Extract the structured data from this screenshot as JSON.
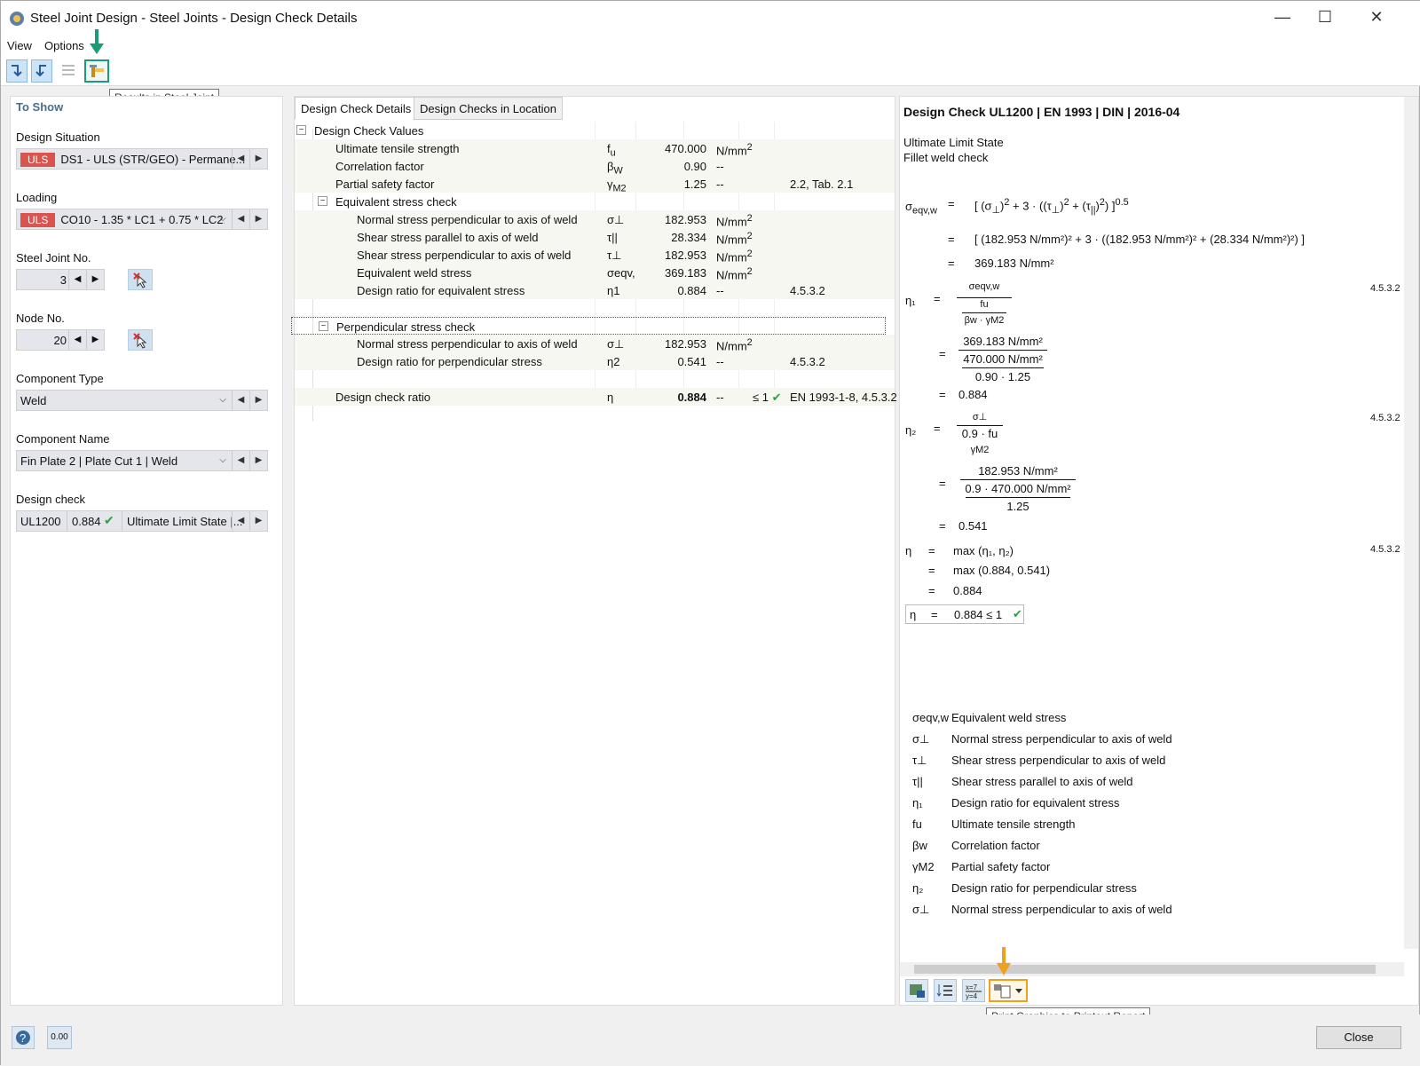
{
  "window": {
    "title": "Steel Joint Design - Steel Joints - Design Check Details",
    "minimize": "—",
    "maximize": "☐",
    "close": "✕"
  },
  "menu": {
    "view": "View",
    "options": "Options"
  },
  "tooltips": {
    "results_in_joint": "Results in Steel Joint",
    "print_graphics": "Print Graphics to Printout Report"
  },
  "left": {
    "header": "To Show",
    "design_situation_label": "Design Situation",
    "design_situation_badge": "ULS",
    "design_situation_value": "DS1 - ULS (STR/GEO) - Permane...",
    "loading_label": "Loading",
    "loading_badge": "ULS",
    "loading_value": "CO10 - 1.35 * LC1 + 0.75 * LC2...",
    "joint_label": "Steel Joint No.",
    "joint_value": "3",
    "node_label": "Node No.",
    "node_value": "20",
    "component_type_label": "Component Type",
    "component_type_value": "Weld",
    "component_name_label": "Component Name",
    "component_name_value": "Fin Plate 2 | Plate Cut 1 | Weld",
    "design_check_label": "Design check",
    "design_check_id": "UL1200",
    "design_check_ratio": "0.884",
    "design_check_desc": "Ultimate Limit State |..."
  },
  "tabs": [
    "Design Check Details",
    "Design Checks in Location"
  ],
  "grid": {
    "group_main": "Design Check Values",
    "rows": [
      {
        "name": "Ultimate tensile strength",
        "sym": "fu",
        "val": "470.000",
        "unit": "N/mm²",
        "cmp": "",
        "ref": ""
      },
      {
        "name": "Correlation factor",
        "sym": "βw",
        "val": "0.90",
        "unit": "--",
        "cmp": "",
        "ref": ""
      },
      {
        "name": "Partial safety factor",
        "sym": "γM2",
        "val": "1.25",
        "unit": "--",
        "cmp": "",
        "ref": "2.2, Tab. 2.1"
      }
    ],
    "group_equiv": "Equivalent stress check",
    "equiv_rows": [
      {
        "name": "Normal stress perpendicular to axis of weld",
        "sym": "σ⊥",
        "val": "182.953",
        "unit": "N/mm²",
        "ref": ""
      },
      {
        "name": "Shear stress parallel to axis of weld",
        "sym": "τ||",
        "val": "28.334",
        "unit": "N/mm²",
        "ref": ""
      },
      {
        "name": "Shear stress perpendicular to axis of weld",
        "sym": "τ⊥",
        "val": "182.953",
        "unit": "N/mm²",
        "ref": ""
      },
      {
        "name": "Equivalent weld stress",
        "sym": "σeqv,",
        "val": "369.183",
        "unit": "N/mm²",
        "ref": ""
      },
      {
        "name": "Design ratio for equivalent stress",
        "sym": "η1",
        "val": "0.884",
        "unit": "--",
        "ref": "4.5.3.2"
      }
    ],
    "group_perp": "Perpendicular stress check",
    "perp_rows": [
      {
        "name": "Normal stress perpendicular to axis of weld",
        "sym": "σ⊥",
        "val": "182.953",
        "unit": "N/mm²",
        "ref": ""
      },
      {
        "name": "Design ratio for perpendicular stress",
        "sym": "η2",
        "val": "0.541",
        "unit": "--",
        "ref": "4.5.3.2"
      }
    ],
    "final": {
      "name": "Design check ratio",
      "sym": "η",
      "val": "0.884",
      "unit": "--",
      "cmp": "≤ 1",
      "ref": "EN 1993-1-8, 4.5.3.2"
    }
  },
  "details": {
    "title": "Design Check UL1200 | EN 1993 | DIN | 2016-04",
    "line1": "Ultimate Limit State",
    "line2": "Fillet weld check",
    "sigma_eqv": "σ",
    "sigma_eqv_sub": "eqv,w",
    "eq": "=",
    "formula1": "[ (σ⊥)² + 3 · ((τ⊥)² + (τ||)²) ]",
    "exp05": "0.5",
    "formula2": "[ (182.953 N/mm²)² + 3 · ((182.953 N/mm²)² + (28.334 N/mm²)²) ]",
    "result1": "369.183 N/mm²",
    "eta1": "η₁",
    "f_sigma": "σeqv,w",
    "f_fu": "fu",
    "f_beta": "βw · γM2",
    "f_num": "369.183 N/mm²",
    "f_den": "470.000 N/mm²",
    "f_den2": "0.90 · 1.25",
    "res_eta1": "0.884",
    "eta2": "η₂",
    "g_sigma": "σ⊥",
    "g_den": "0.9 · fu",
    "g_gamma": "γM2",
    "g_num": "182.953 N/mm²",
    "g_den1": "0.9 · 470.000 N/mm²",
    "g_den2": "1.25",
    "res_eta2": "0.541",
    "eta": "η",
    "max1": "max (η₁, η₂)",
    "max2": "max (0.884, 0.541)",
    "res_eta": "0.884",
    "final": "0.884 ≤ 1",
    "ref": "4.5.3.2"
  },
  "legend": [
    {
      "sym": "σeqv,w",
      "txt": "Equivalent weld stress"
    },
    {
      "sym": "σ⊥",
      "txt": "Normal stress perpendicular to axis of weld"
    },
    {
      "sym": "τ⊥",
      "txt": "Shear stress perpendicular to axis of weld"
    },
    {
      "sym": "τ||",
      "txt": "Shear stress parallel to axis of weld"
    },
    {
      "sym": "η₁",
      "txt": "Design ratio for equivalent stress"
    },
    {
      "sym": "fu",
      "txt": "Ultimate tensile strength"
    },
    {
      "sym": "βw",
      "txt": "Correlation factor"
    },
    {
      "sym": "γM2",
      "txt": "Partial safety factor"
    },
    {
      "sym": "η₂",
      "txt": "Design ratio for perpendicular stress"
    },
    {
      "sym": "σ⊥",
      "txt": "Normal stress perpendicular to axis of weld"
    }
  ],
  "status": {
    "close": "Close",
    "decimal": "0.00"
  },
  "colors": {
    "accent_green": "#1a9c7a",
    "accent_orange": "#f0a020",
    "uls_red": "#d9534f",
    "check_green": "#2e9e3e"
  }
}
